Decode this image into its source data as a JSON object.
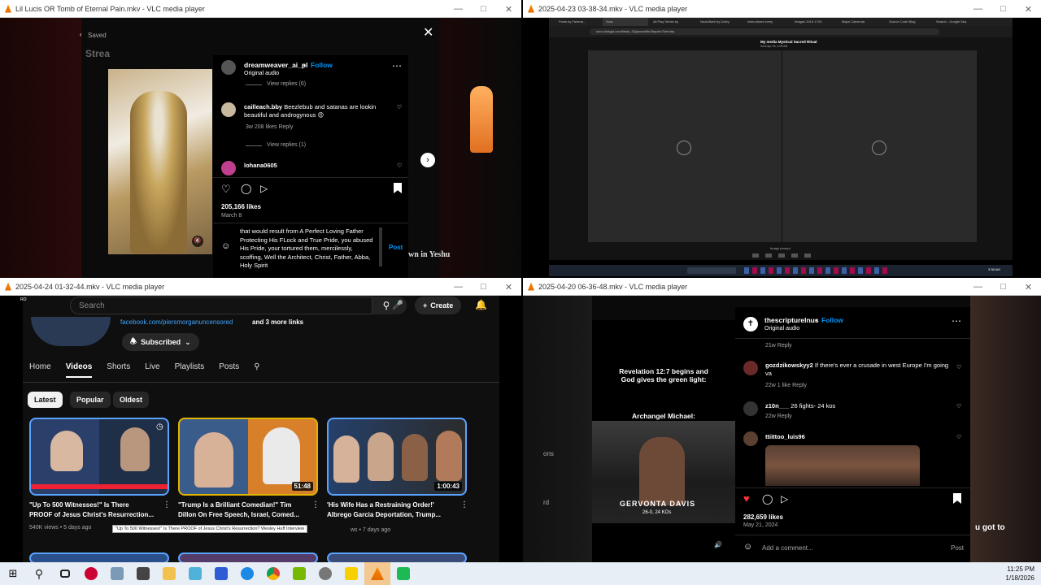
{
  "win1": {
    "title": "Lil Lucis OR Tomb of Eternal Pain.mkv - VLC media player",
    "saved": "Saved",
    "stream": "Strea",
    "account": "dreamweaver_ai_pl",
    "follow": "Follow",
    "audio": "Original audio",
    "view_replies_6": "View replies (6)",
    "c1_user": "cailleach.bby",
    "c1_text": "Beezlebub and satanas are lookin beautiful and androgynous 😍",
    "c1_meta": "3w   208 likes   Reply",
    "view_replies_1": "View replies (1)",
    "c2_user": "lohana0605",
    "likes": "205,166 likes",
    "date": "March 8",
    "draft": "that would result from A Perfect Loving Father Protecting His FLock and True Pride, you abused His Pride, your tortured them, mercilessly, scoffing, Well the Architect, Christ, Father, Abba, Holy Spirit",
    "post": "Post",
    "bg_text": "wn in Yeshu"
  },
  "win2": {
    "title": "2025-04-23 03-38-34.mkv - VLC media player",
    "tabs": [
      "Posts by Farlend...",
      "Sora",
      "All Play Series by",
      "NeoloBarb by Dolby",
      "instructions every",
      "Images 2019-1700",
      "Major Calvenda",
      "Source Code Blog",
      "Search - Google Sea"
    ],
    "url": "sora.chatgpt.com/t/task_01jqwxzw6kr3bqcdvr7kmr4ep",
    "heading": "My media    Mystical Sacred Ritual",
    "sub": "Sora    Apr 23, 4:05 AM",
    "prompt": "Image prompt",
    "time": "3:38 AM"
  },
  "win3": {
    "title": "2025-04-24 01-32-44.mkv - VLC media player",
    "search_placeholder": "Search",
    "create": "Create",
    "links": "facebook.com/piersmorganuncensored",
    "links_more": "and 3 more links",
    "subscribed": "Subscribed",
    "tabs": [
      "Home",
      "Videos",
      "Shorts",
      "Live",
      "Playlists",
      "Posts"
    ],
    "chips": [
      "Latest",
      "Popular",
      "Oldest"
    ],
    "videos": [
      {
        "title1": "\"Up To 500 Witnesses!\" Is There",
        "title2": "PROOF of Jesus Christ's Resurrection...",
        "meta": "540K views • 5 days ago",
        "dur": ""
      },
      {
        "title1": "\"Trump Is a Brilliant Comedian!\" Tim",
        "title2": "Dillon On Free Speech, Israel, Comed...",
        "meta": "",
        "dur": "51:48"
      },
      {
        "title1": "'His Wife Has a Restraining Order!'",
        "title2": "Albrego Garcia Deportation, Trump...",
        "meta": "ws • 7 days ago",
        "dur": "1:00:43"
      }
    ],
    "tooltip": "\"Up To 500 Witnesses!\" Is There PROOF of Jesus Christ's Resurrection? Wesley Huff Interview",
    "side_text": "RO"
  },
  "win4": {
    "title": "2025-04-20 06-36-48.mkv - VLC media player",
    "caption1": "Revelation 12:7 begins and God gives the green light:",
    "caption2": "Archangel Michael:",
    "fighter": "GERVONTA DAVIS",
    "fighter_sub": "26-0, 24 KOs",
    "account": "thescripturelnus",
    "follow": "Follow",
    "audio": "Original audio",
    "c0_meta": "21w   Reply",
    "c1_user": "gozdzikowskyy2",
    "c1_text": "If there's ever a crusade in west Europe I'm going va",
    "c1_meta": "22w   1 like   Reply",
    "c2_user": "z10n___",
    "c2_text": "26 fights- 24 kos",
    "c2_meta": "22w   Reply",
    "c3_user": "ttiittoo_luis96",
    "likes": "282,659 likes",
    "date": "May 21, 2024",
    "add_comment": "Add a comment...",
    "post": "Post",
    "side1": "ons",
    "side2": "rd",
    "side3": "u got to"
  },
  "taskbar": {
    "time": "11:25 PM",
    "date": "1/18/2026"
  },
  "colors": {
    "instagram_blue": "#0095f6",
    "heart_red": "#ff3040",
    "youtube_bg": "#0f0f0f",
    "vlc_orange": "#ff8800"
  }
}
